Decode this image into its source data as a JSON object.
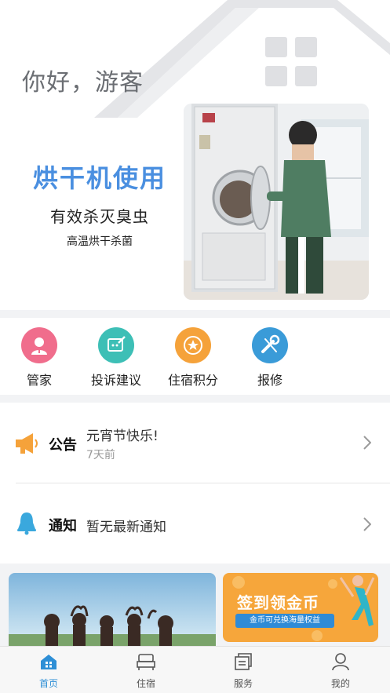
{
  "header": {
    "greeting": "你好，游客"
  },
  "banner": {
    "title": "烘干机使用",
    "subtitle": "有效杀灭臭虫",
    "caption": "高温烘干杀菌"
  },
  "menu": [
    {
      "label": "管家",
      "icon": "butler-icon",
      "color": "#f06d8c"
    },
    {
      "label": "投诉建议",
      "icon": "feedback-icon",
      "color": "#3dbfb6"
    },
    {
      "label": "住宿积分",
      "icon": "points-icon",
      "color": "#f5a23a"
    },
    {
      "label": "报修",
      "icon": "repair-icon",
      "color": "#3a9bd8"
    }
  ],
  "announcement": {
    "tag": "公告",
    "text": "元宵节快乐!",
    "time": "7天前",
    "icon": "megaphone-icon"
  },
  "notification": {
    "tag": "通知",
    "text": "暂无最新通知",
    "icon": "bell-icon"
  },
  "promo": {
    "coins_title": "签到领金币",
    "coins_sub": "金币可兑换海量权益"
  },
  "tabbar": [
    {
      "label": "首页",
      "icon": "home-icon",
      "active": true
    },
    {
      "label": "住宿",
      "icon": "bed-icon",
      "active": false
    },
    {
      "label": "服务",
      "icon": "service-icon",
      "active": false
    },
    {
      "label": "我的",
      "icon": "user-icon",
      "active": false
    }
  ],
  "colors": {
    "accent": "#2e8fd6",
    "banner_title": "#4a8fe0",
    "coins_bg": "#f6a63b"
  }
}
